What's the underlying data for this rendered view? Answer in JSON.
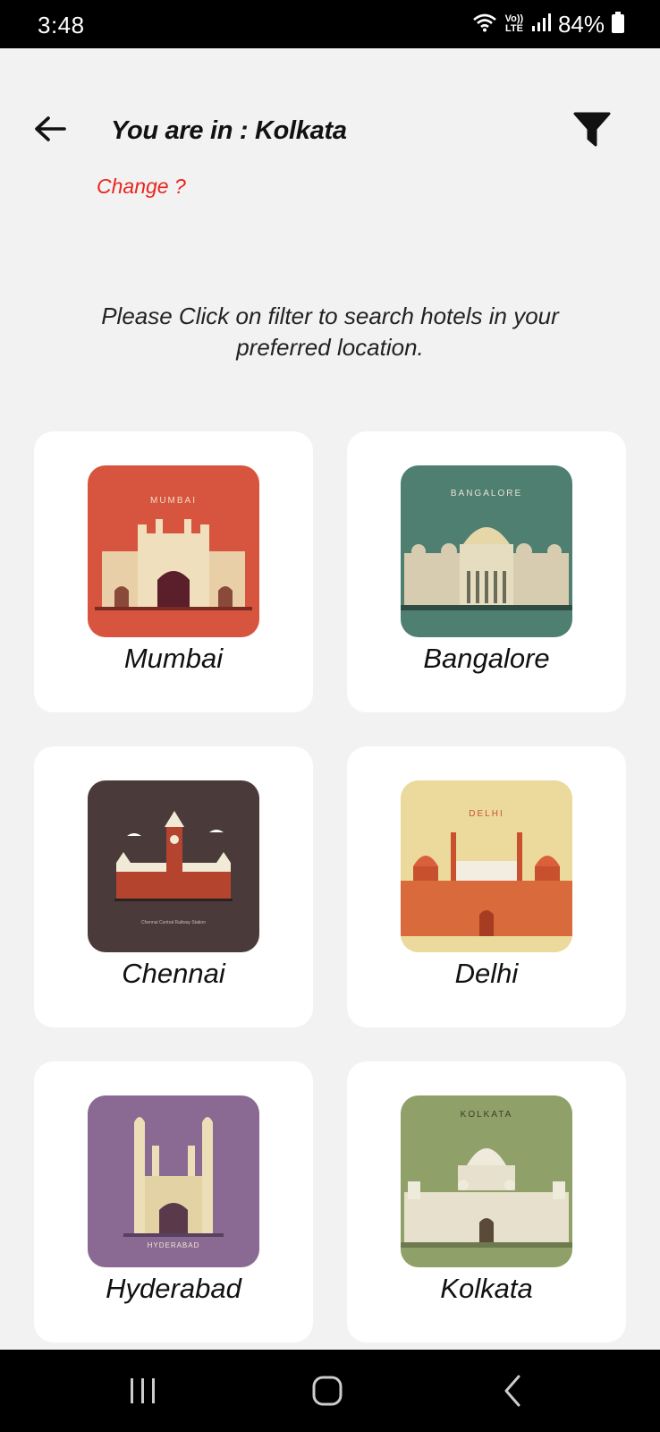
{
  "status_bar": {
    "time": "3:48",
    "network_top": "Vo))",
    "network_bottom": "LTE",
    "battery": "84%"
  },
  "header": {
    "title": "You are in : Kolkata",
    "change_link": "Change ?"
  },
  "info_text": "Please Click on filter to search hotels in your preferred location.",
  "cities": [
    {
      "name": "Mumbai",
      "thumb_caption": "MUMBAI",
      "bg": "#d7553e"
    },
    {
      "name": "Bangalore",
      "thumb_caption": "BANGALORE",
      "bg": "#4f7f71"
    },
    {
      "name": "Chennai",
      "thumb_caption": "Chennai Central Railway Station",
      "bg": "#4a3b3a"
    },
    {
      "name": "Delhi",
      "thumb_caption": "DELHI",
      "bg": "#ecd99c"
    },
    {
      "name": "Hyderabad",
      "thumb_caption": "HYDERABAD",
      "bg": "#8a6a93"
    },
    {
      "name": "Kolkata",
      "thumb_caption": "KOLKATA",
      "bg": "#8fa069"
    }
  ],
  "colors": {
    "accent_red": "#e8261f",
    "background": "#f2f2f2",
    "card": "#ffffff"
  }
}
